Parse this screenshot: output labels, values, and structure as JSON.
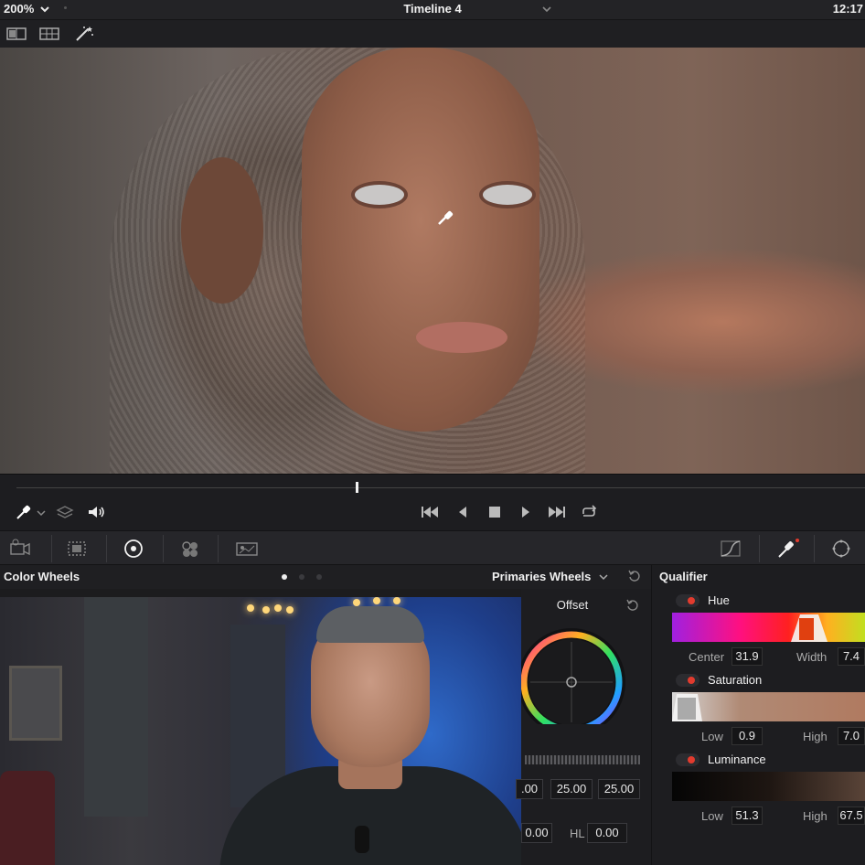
{
  "topbar": {
    "zoom": "200%",
    "timeline": "Timeline 4",
    "clock": "12:17"
  },
  "color_wheels": {
    "title": "Color Wheels",
    "mode": "Primaries Wheels",
    "offset_label": "Offset",
    "values": [
      ".00",
      "25.00",
      "25.00"
    ],
    "bottom_value": "0.00",
    "hl_label": "HL",
    "hl_value": "0.00"
  },
  "qualifier": {
    "title": "Qualifier",
    "hue": {
      "label": "Hue",
      "center_label": "Center",
      "center": "31.9",
      "width_label": "Width",
      "width": "7.4"
    },
    "saturation": {
      "label": "Saturation",
      "low_label": "Low",
      "low": "0.9",
      "high_label": "High",
      "high": "7.0"
    },
    "luminance": {
      "label": "Luminance",
      "low_label": "Low",
      "low": "51.3",
      "high_label": "High",
      "high": "67.5"
    }
  },
  "colors": {
    "accent_red": "#e23b2e",
    "panel": "#1d1d20",
    "text": "#f0f0f0"
  },
  "icons": [
    "chevron-down-icon",
    "dual-view-icon",
    "grid-view-icon",
    "magic-wand-icon",
    "eyedropper-icon",
    "layers-icon",
    "speaker-icon",
    "skip-back-icon",
    "play-reverse-icon",
    "stop-icon",
    "play-icon",
    "skip-forward-icon",
    "loop-icon",
    "reset-icon"
  ]
}
